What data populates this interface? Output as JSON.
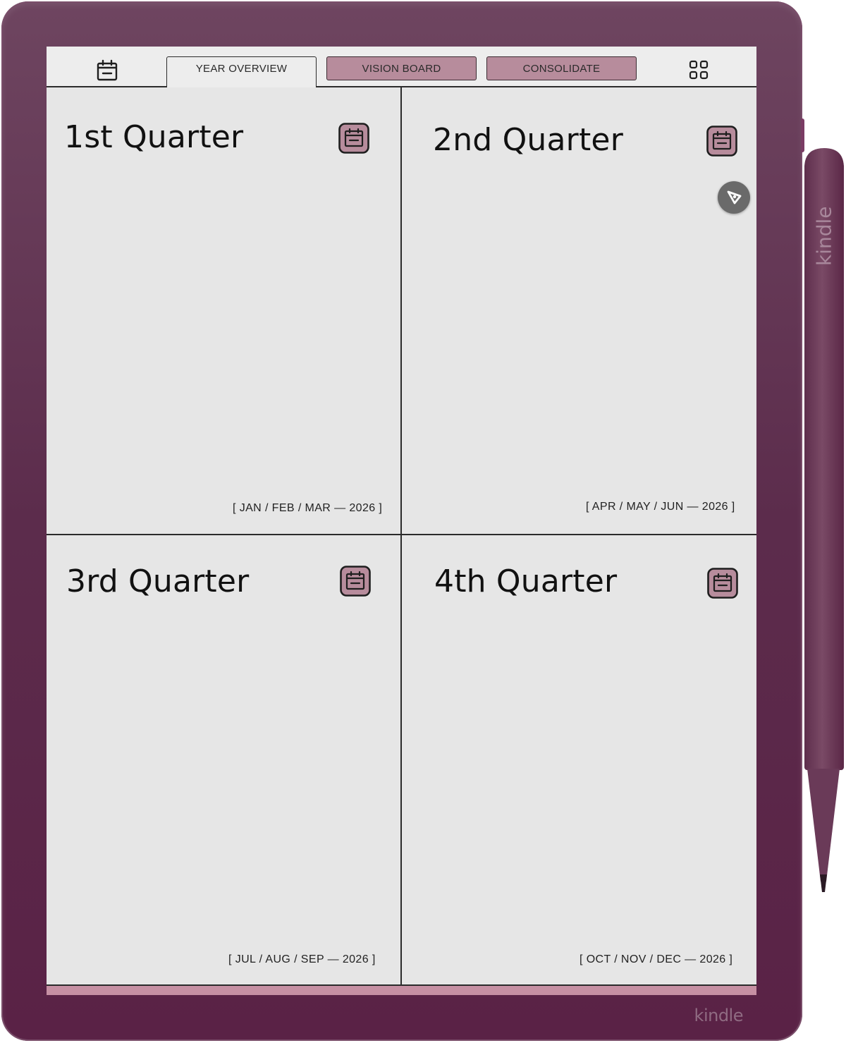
{
  "tabs": {
    "year_overview": "YEAR OVERVIEW",
    "vision_board": "VISION BOARD",
    "consolidate": "CONSOLIDATE"
  },
  "quarters": [
    {
      "title": "1st Quarter",
      "months": "[ JAN / FEB / MAR — 2026 ]"
    },
    {
      "title": "2nd Quarter",
      "months": "[ APR / MAY / JUN — 2026 ]"
    },
    {
      "title": "3rd Quarter",
      "months": "[ JUL / AUG / SEP — 2026 ]"
    },
    {
      "title": "4th Quarter",
      "months": "[ OCT / NOV / DEC — 2026 ]"
    }
  ],
  "device": {
    "brand": "kindle",
    "stylus_brand": "kindle"
  },
  "icons": {
    "calendar": "calendar-icon",
    "grid": "grid-icon",
    "pen": "pen-tool-icon"
  },
  "colors": {
    "device_body": "#5c2c4c",
    "accent_pink": "#b78c9c",
    "screen": "#e6e6e6"
  }
}
